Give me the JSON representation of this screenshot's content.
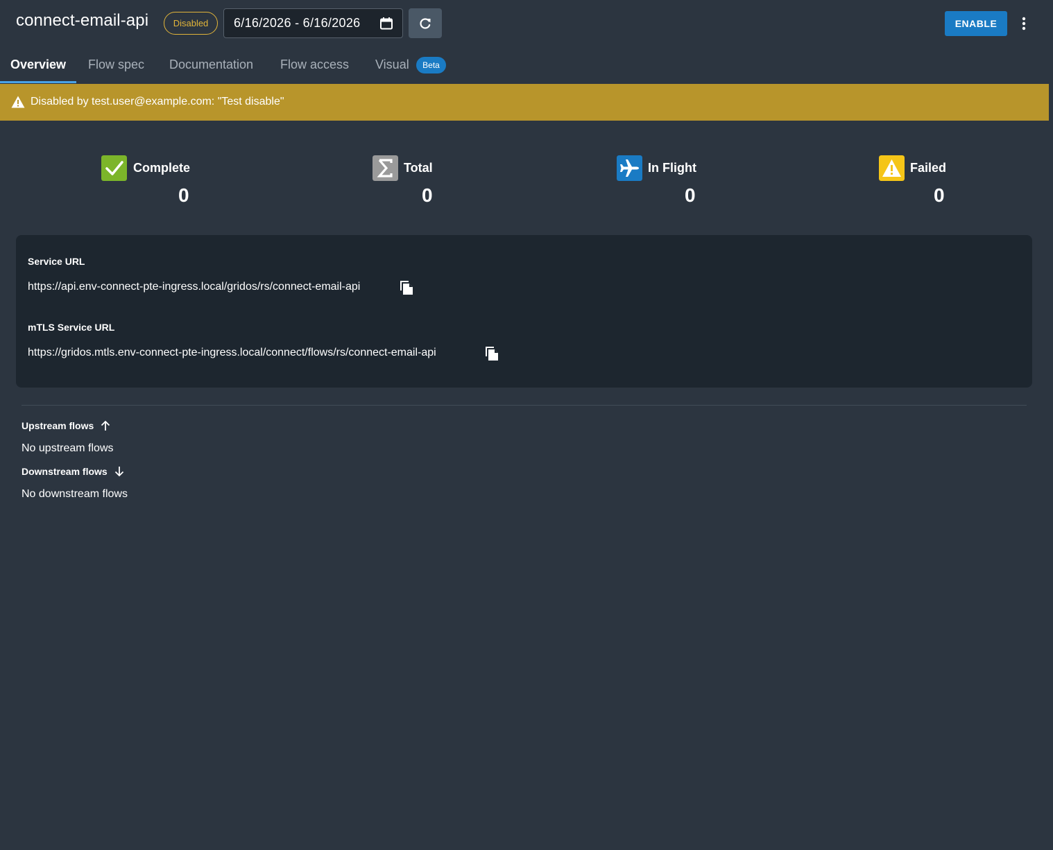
{
  "header": {
    "title": "connect-email-api",
    "status": "Disabled",
    "date_range": "6/16/2026 - 6/16/2026",
    "enable_label": "ENABLE"
  },
  "tabs": [
    {
      "label": "Overview",
      "active": true
    },
    {
      "label": "Flow spec",
      "active": false
    },
    {
      "label": "Documentation",
      "active": false
    },
    {
      "label": "Flow access",
      "active": false
    },
    {
      "label": "Visual",
      "active": false,
      "badge": "Beta"
    }
  ],
  "banner": {
    "text": "Disabled by test.user@example.com: \"Test disable\""
  },
  "stats": [
    {
      "label": "Complete",
      "value": "0",
      "icon": "check-icon",
      "color": "#7cb52a"
    },
    {
      "label": "Total",
      "value": "0",
      "icon": "sigma-icon",
      "color": "#9a9a9a"
    },
    {
      "label": "In Flight",
      "value": "0",
      "icon": "airplane-icon",
      "color": "#1a7bc4"
    },
    {
      "label": "Failed",
      "value": "0",
      "icon": "warning-icon",
      "color": "#f5c518"
    }
  ],
  "urls": {
    "service_label": "Service URL",
    "service_value": "https://api.env-connect-pte-ingress.local/gridos/rs/connect-email-api",
    "mtls_label": "mTLS Service URL",
    "mtls_value": "https://gridos.mtls.env-connect-pte-ingress.local/connect/flows/rs/connect-email-api"
  },
  "flows": {
    "upstream_heading": "Upstream flows",
    "upstream_empty": "No upstream flows",
    "downstream_heading": "Downstream flows",
    "downstream_empty": "No downstream flows"
  }
}
